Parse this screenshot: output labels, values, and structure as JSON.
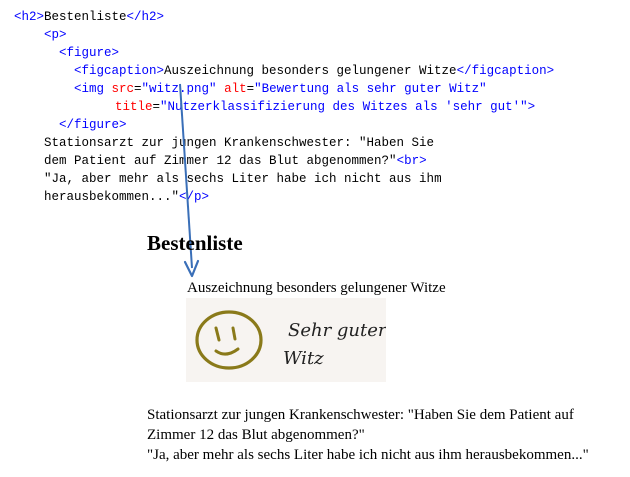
{
  "code": {
    "l1": {
      "open_tag": "<h2>",
      "text": "Bestenliste",
      "close_tag": "</h2>"
    },
    "l2": {
      "tag": "<p>"
    },
    "l3": {
      "tag": "<figure>"
    },
    "l4": {
      "open_tag": "<figcaption>",
      "text": "Auszeichnung besonders gelungener Witze",
      "close_tag": "</figcaption>"
    },
    "l5": {
      "tag_start": "<img ",
      "src_attr": "src",
      "eq1": "=",
      "src_val": "\"witz.png\"",
      "alt_attr": "alt",
      "eq2": "=",
      "alt_val": "\"Bewertung als sehr guter Witz\""
    },
    "l6": {
      "title_attr": "title",
      "eq": "=",
      "title_val": "\"Nutzerklassifizierung des Witzes als 'sehr gut'\"",
      "tag_end": ">"
    },
    "l7": {
      "tag": "</figure>"
    },
    "l8": {
      "text": "Stationsarzt zur jungen Krankenschwester: \"Haben Sie"
    },
    "l9": {
      "text": "dem Patient auf Zimmer 12 das Blut abgenommen?\"",
      "tag": "<br>"
    },
    "l10": {
      "text": "\"Ja, aber mehr als sechs Liter habe ich nicht aus ihm"
    },
    "l11": {
      "text": "herausbekommen...\"",
      "tag": "</p>"
    }
  },
  "render": {
    "title": "Bestenliste",
    "caption": "Auszeichnung besonders gelungener Witze",
    "image": {
      "line1": "Sehr guter",
      "line2": "Witz"
    },
    "paragraph": {
      "line1": "Stationsarzt zur jungen Krankenschwester: \"Haben Sie dem Patient auf",
      "line2": "Zimmer 12 das Blut abgenommen?\"",
      "line3": "\"Ja, aber mehr als sechs Liter habe ich nicht aus ihm herausbekommen...\""
    }
  },
  "colors": {
    "tag": "#0000ff",
    "attribute": "#ff0000",
    "text": "#000000",
    "arrow": "#3a6fb8",
    "smiley": "#8a7a1a",
    "image_bg": "#f7f4f1"
  },
  "icons": {
    "arrow": "down-arrow-icon",
    "smiley": "smiley-face-icon"
  }
}
